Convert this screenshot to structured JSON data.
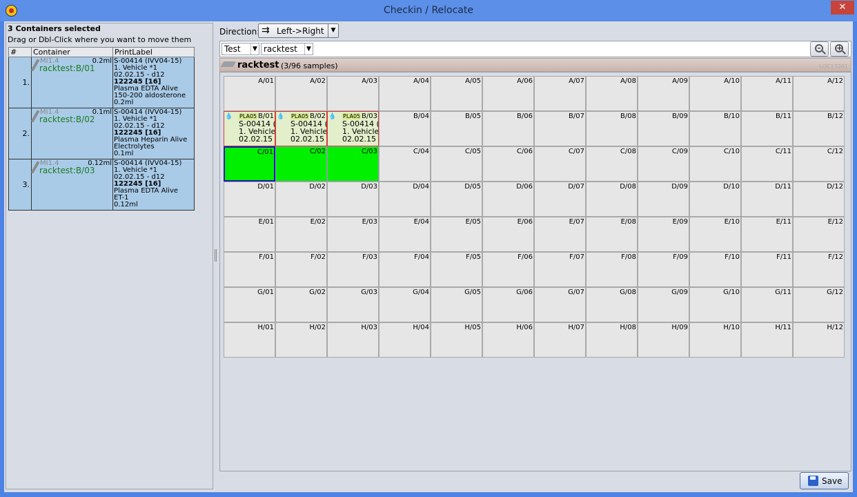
{
  "window": {
    "title": "Checkin / Relocate",
    "close_label": "✕"
  },
  "left": {
    "selected_count_text": "3 Containers selected",
    "instructions": "Drag or Dbl-Click where you want to move them",
    "columns": [
      "#",
      "Container",
      "PrintLabel"
    ],
    "rows": [
      {
        "num": "1.",
        "code": "MI1.4",
        "volume": "0.2ml",
        "location": "racktest:B/01",
        "label": {
          "l1": "S-00414 (IVV04-15)",
          "l2": "1. Vehicle *1",
          "l3": "02.02.15 - d12",
          "l4": "122245 [16]",
          "l5": "Plasma EDTA Alive",
          "l6": "150-200 aldosterone",
          "l7": "0.2ml"
        }
      },
      {
        "num": "2.",
        "code": "MI1.4",
        "volume": "0.1ml",
        "location": "racktest:B/02",
        "label": {
          "l1": "S-00414 (IVV04-15)",
          "l2": "1. Vehicle *1",
          "l3": "02.02.15 - d12",
          "l4": "122245 [16]",
          "l5": "Plasma Heparin Alive",
          "l6": "Electrolytes",
          "l7": "0.1ml"
        }
      },
      {
        "num": "3.",
        "code": "MI1.4",
        "volume": "0.12ml",
        "location": "racktest:B/03",
        "label": {
          "l1": "S-00414 (IVV04-15)",
          "l2": "1. Vehicle *1",
          "l3": "02.02.15 - d12",
          "l4": "122245 [16]",
          "l5": "Plasma EDTA Alive",
          "l6": "ET-1",
          "l7": "0.12ml"
        }
      }
    ]
  },
  "right": {
    "direction_label": "Direction:",
    "direction_value": "Left->Right",
    "filter1": "Test",
    "filter2": "racktest",
    "rack_name": "racktest",
    "rack_count": "(3/96 samples)",
    "rack_loc": "LOC13201",
    "rows": [
      "A",
      "B",
      "C",
      "D",
      "E",
      "F",
      "G",
      "H"
    ],
    "cols": [
      "01",
      "02",
      "03",
      "04",
      "05",
      "06",
      "07",
      "08",
      "09",
      "10",
      "11",
      "12"
    ],
    "filled_cells": {
      "B/01": {
        "tag": "PLA05",
        "l1": "S-00414 (",
        "l2": "1. Vehicle",
        "l3": "02.02.15"
      },
      "B/02": {
        "tag": "PLA05",
        "l1": "S-00414 (",
        "l2": "1. Vehicle",
        "l3": "02.02.15"
      },
      "B/03": {
        "tag": "PLA05",
        "l1": "S-00414 (",
        "l2": "1. Vehicle",
        "l3": "02.02.15"
      }
    },
    "target_cells": [
      "C/01",
      "C/02",
      "C/03"
    ],
    "selected_cell": "C/01",
    "save_label": "Save"
  }
}
